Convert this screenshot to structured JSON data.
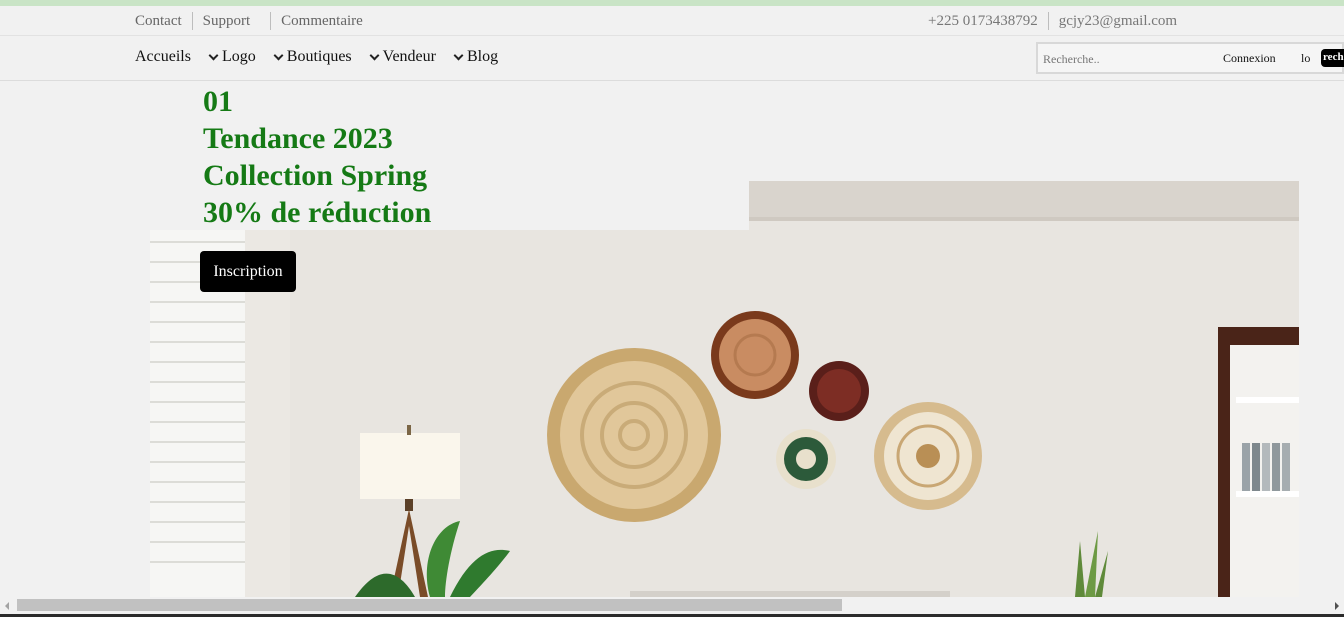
{
  "topbar": {
    "links": [
      "Contact",
      "Support",
      "Commentaire"
    ],
    "phone": "+225 0173438792",
    "email": "gcjy23@gmail.com"
  },
  "nav": {
    "items": [
      {
        "label": "Accueils"
      },
      {
        "label": "Logo"
      },
      {
        "label": "Boutiques"
      },
      {
        "label": "Vendeur"
      },
      {
        "label": "Blog"
      }
    ]
  },
  "search": {
    "placeholder": "Recherche..",
    "button_label": "recherche"
  },
  "auth": {
    "login_label": "Connexion",
    "extra_label": "lo"
  },
  "hero": {
    "lines": [
      "01",
      "Tendance 2023",
      "Collection Spring",
      "30% de réduction"
    ],
    "cta_label": "Inscription"
  },
  "colors": {
    "accent_green": "#157a15",
    "top_accent": "#c9e4c6"
  }
}
